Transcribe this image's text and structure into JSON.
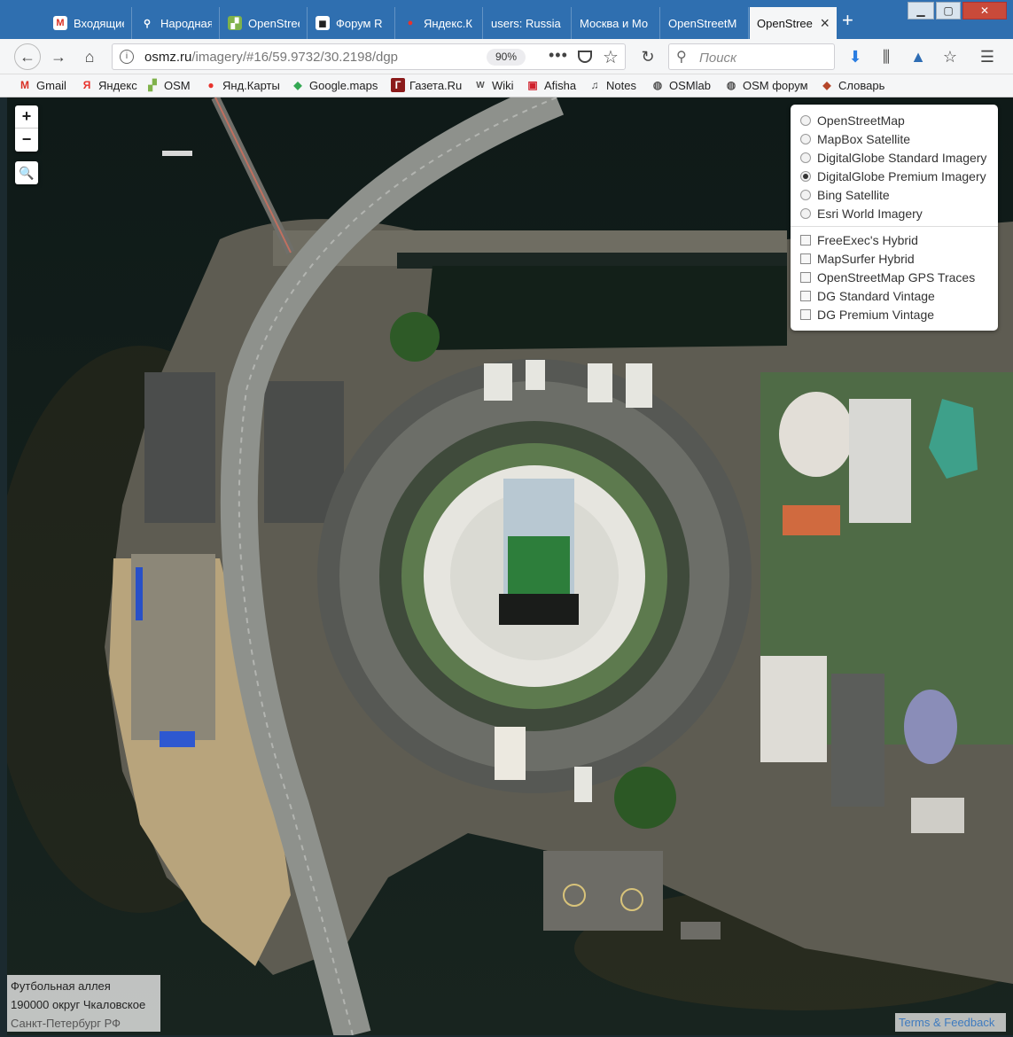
{
  "tabs": [
    {
      "label": "Входящие",
      "icon": "gmail-icon",
      "icon_char": "M",
      "icon_color": "#d93025",
      "active": false
    },
    {
      "label": "Народная",
      "icon": "map-pin-icon",
      "icon_char": "⚲",
      "icon_color": "#ffffff",
      "active": false
    },
    {
      "label": "OpenStreetMap",
      "icon": "osm-icon",
      "icon_char": "▞",
      "icon_color": "#7fb24b",
      "active": false
    },
    {
      "label": "Форум R",
      "icon": "forum-icon",
      "icon_char": "◼",
      "icon_color": "#222222",
      "active": false
    },
    {
      "label": "Яндекс.К",
      "icon": "yandex-maps-icon",
      "icon_char": "●",
      "icon_color": "#e8322c",
      "active": false
    },
    {
      "label": "users: Russia",
      "icon": "",
      "icon_char": "",
      "icon_color": "",
      "active": false
    },
    {
      "label": "Москва и Мо",
      "icon": "",
      "icon_char": "",
      "icon_color": "",
      "active": false
    },
    {
      "label": "OpenStreetM",
      "icon": "",
      "icon_char": "",
      "icon_color": "",
      "active": false
    },
    {
      "label": "OpenStree",
      "icon": "",
      "icon_char": "",
      "icon_color": "",
      "active": true
    }
  ],
  "nav": {
    "url_host": "osmz.ru",
    "url_rest": "/imagery/#16/59.9732/30.2198/dgp",
    "zoom": "90%",
    "search_placeholder": "Поиск"
  },
  "bookmarks": [
    {
      "label": "Gmail",
      "icon": "gmail-icon",
      "icon_char": "M",
      "color": "#d93025"
    },
    {
      "label": "Яндекс",
      "icon": "yandex-icon",
      "icon_char": "Я",
      "color": "#e8322c"
    },
    {
      "label": "OSM",
      "icon": "osm-icon",
      "icon_char": "▞",
      "color": "#7fb24b"
    },
    {
      "label": "Янд.Карты",
      "icon": "map-pin-icon",
      "icon_char": "●",
      "color": "#e8322c"
    },
    {
      "label": "Google.maps",
      "icon": "google-maps-icon",
      "icon_char": "◆",
      "color": "#34a853"
    },
    {
      "label": "Газета.Ru",
      "icon": "gazeta-icon",
      "icon_char": "Г",
      "color": "#8b1a1a"
    },
    {
      "label": "Wiki",
      "icon": "wiki-icon",
      "icon_char": "W",
      "color": "#555555"
    },
    {
      "label": "Afisha",
      "icon": "afisha-icon",
      "icon_char": "▣",
      "color": "#d0202c"
    },
    {
      "label": "Notes",
      "icon": "notes-icon",
      "icon_char": "♫",
      "color": "#444444"
    },
    {
      "label": "OSMlab",
      "icon": "globe-icon",
      "icon_char": "◍",
      "color": "#555555"
    },
    {
      "label": "OSM форум",
      "icon": "globe-icon",
      "icon_char": "◍",
      "color": "#555555"
    },
    {
      "label": "Словарь",
      "icon": "dictionary-icon",
      "icon_char": "◆",
      "color": "#b5472a"
    }
  ],
  "map": {
    "zoom_in": "+",
    "zoom_out": "−",
    "search_icon_char": "🔍",
    "base_layers": [
      {
        "label": "OpenStreetMap",
        "selected": false
      },
      {
        "label": "MapBox Satellite",
        "selected": false
      },
      {
        "label": "DigitalGlobe Standard Imagery",
        "selected": false
      },
      {
        "label": "DigitalGlobe Premium Imagery",
        "selected": true
      },
      {
        "label": "Bing Satellite",
        "selected": false
      },
      {
        "label": "Esri World Imagery",
        "selected": false
      }
    ],
    "overlays": [
      {
        "label": "FreeExec's Hybrid",
        "checked": false
      },
      {
        "label": "MapSurfer Hybrid",
        "checked": false
      },
      {
        "label": "OpenStreetMap GPS Traces",
        "checked": false
      },
      {
        "label": "DG Standard Vintage",
        "checked": false
      },
      {
        "label": "DG Premium Vintage",
        "checked": false
      }
    ],
    "address": [
      "Футбольная аллея",
      "190000 округ Чкаловское",
      "Санкт-Петербург РФ"
    ],
    "terms": "Terms & Feedback"
  }
}
